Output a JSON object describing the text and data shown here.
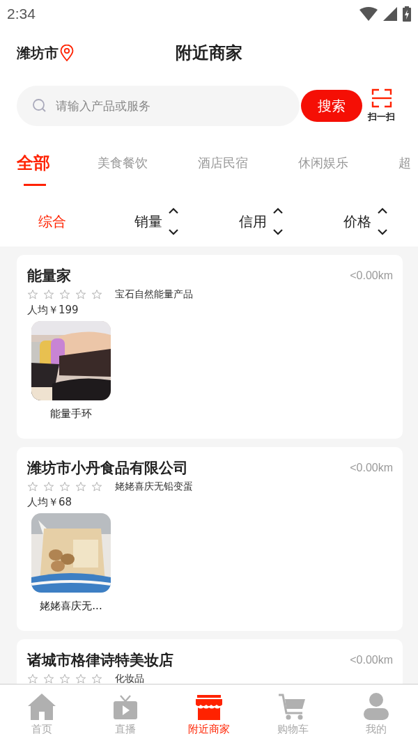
{
  "status_bar": {
    "time": "2:34"
  },
  "header": {
    "city": "潍坊市",
    "title": "附近商家"
  },
  "search": {
    "placeholder": "请输入产品或服务",
    "button": "搜索",
    "scan_label": "扫一扫"
  },
  "tabs": [
    {
      "label": "全部",
      "selected": true
    },
    {
      "label": "美食餐饮",
      "selected": false
    },
    {
      "label": "酒店民宿",
      "selected": false
    },
    {
      "label": "休闲娱乐",
      "selected": false
    },
    {
      "label": "超",
      "selected": false
    }
  ],
  "sort": [
    {
      "label": "综合",
      "selected": true,
      "kind": "plain"
    },
    {
      "label": "销量",
      "selected": false,
      "kind": "toggle"
    },
    {
      "label": "信用",
      "selected": false,
      "kind": "toggle"
    },
    {
      "label": "价格",
      "selected": false,
      "kind": "toggle"
    }
  ],
  "merchants": [
    {
      "name": "能量家",
      "distance": "<0.00km",
      "stars": 0,
      "category": "宝石自然能量产品",
      "avg_price": "人均￥199",
      "products": [
        {
          "name": "能量手环",
          "kind": "picture"
        }
      ]
    },
    {
      "name": "潍坊市小丹食品有限公司",
      "distance": "<0.00km",
      "stars": 0,
      "category": "姥姥喜庆无铅变蛋",
      "avg_price": "人均￥68",
      "products": [
        {
          "name": "姥姥喜庆无...",
          "kind": "picture"
        }
      ]
    },
    {
      "name": "诸城市格律诗特美妆店",
      "distance": "<0.00km",
      "stars": 0,
      "category": "化妆品"
    }
  ],
  "bottom_nav": [
    {
      "label": "首页",
      "selected": false,
      "kind": "home"
    },
    {
      "label": "直播",
      "selected": false,
      "kind": "tv"
    },
    {
      "label": "附近商家",
      "selected": true,
      "kind": "shop"
    },
    {
      "label": "购物车",
      "selected": false,
      "kind": "cart"
    },
    {
      "label": "我的",
      "selected": false,
      "kind": "user"
    }
  ]
}
